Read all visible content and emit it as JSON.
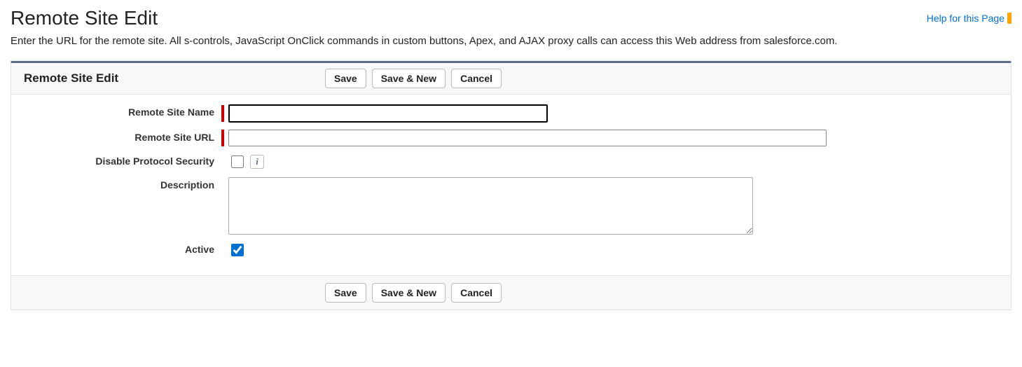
{
  "pageTitle": "Remote Site Edit",
  "helpLink": "Help for this Page",
  "description": "Enter the URL for the remote site. All s-controls, JavaScript OnClick commands in custom buttons, Apex, and AJAX proxy calls can access this Web address from salesforce.com.",
  "section": {
    "title": "Remote Site Edit",
    "buttons": {
      "save": "Save",
      "saveNew": "Save & New",
      "cancel": "Cancel"
    }
  },
  "fields": {
    "siteName": {
      "label": "Remote Site Name",
      "value": ""
    },
    "siteUrl": {
      "label": "Remote Site URL",
      "value": ""
    },
    "disableSecurity": {
      "label": "Disable Protocol Security",
      "checked": false
    },
    "descriptionField": {
      "label": "Description",
      "value": ""
    },
    "active": {
      "label": "Active",
      "checked": true
    }
  }
}
